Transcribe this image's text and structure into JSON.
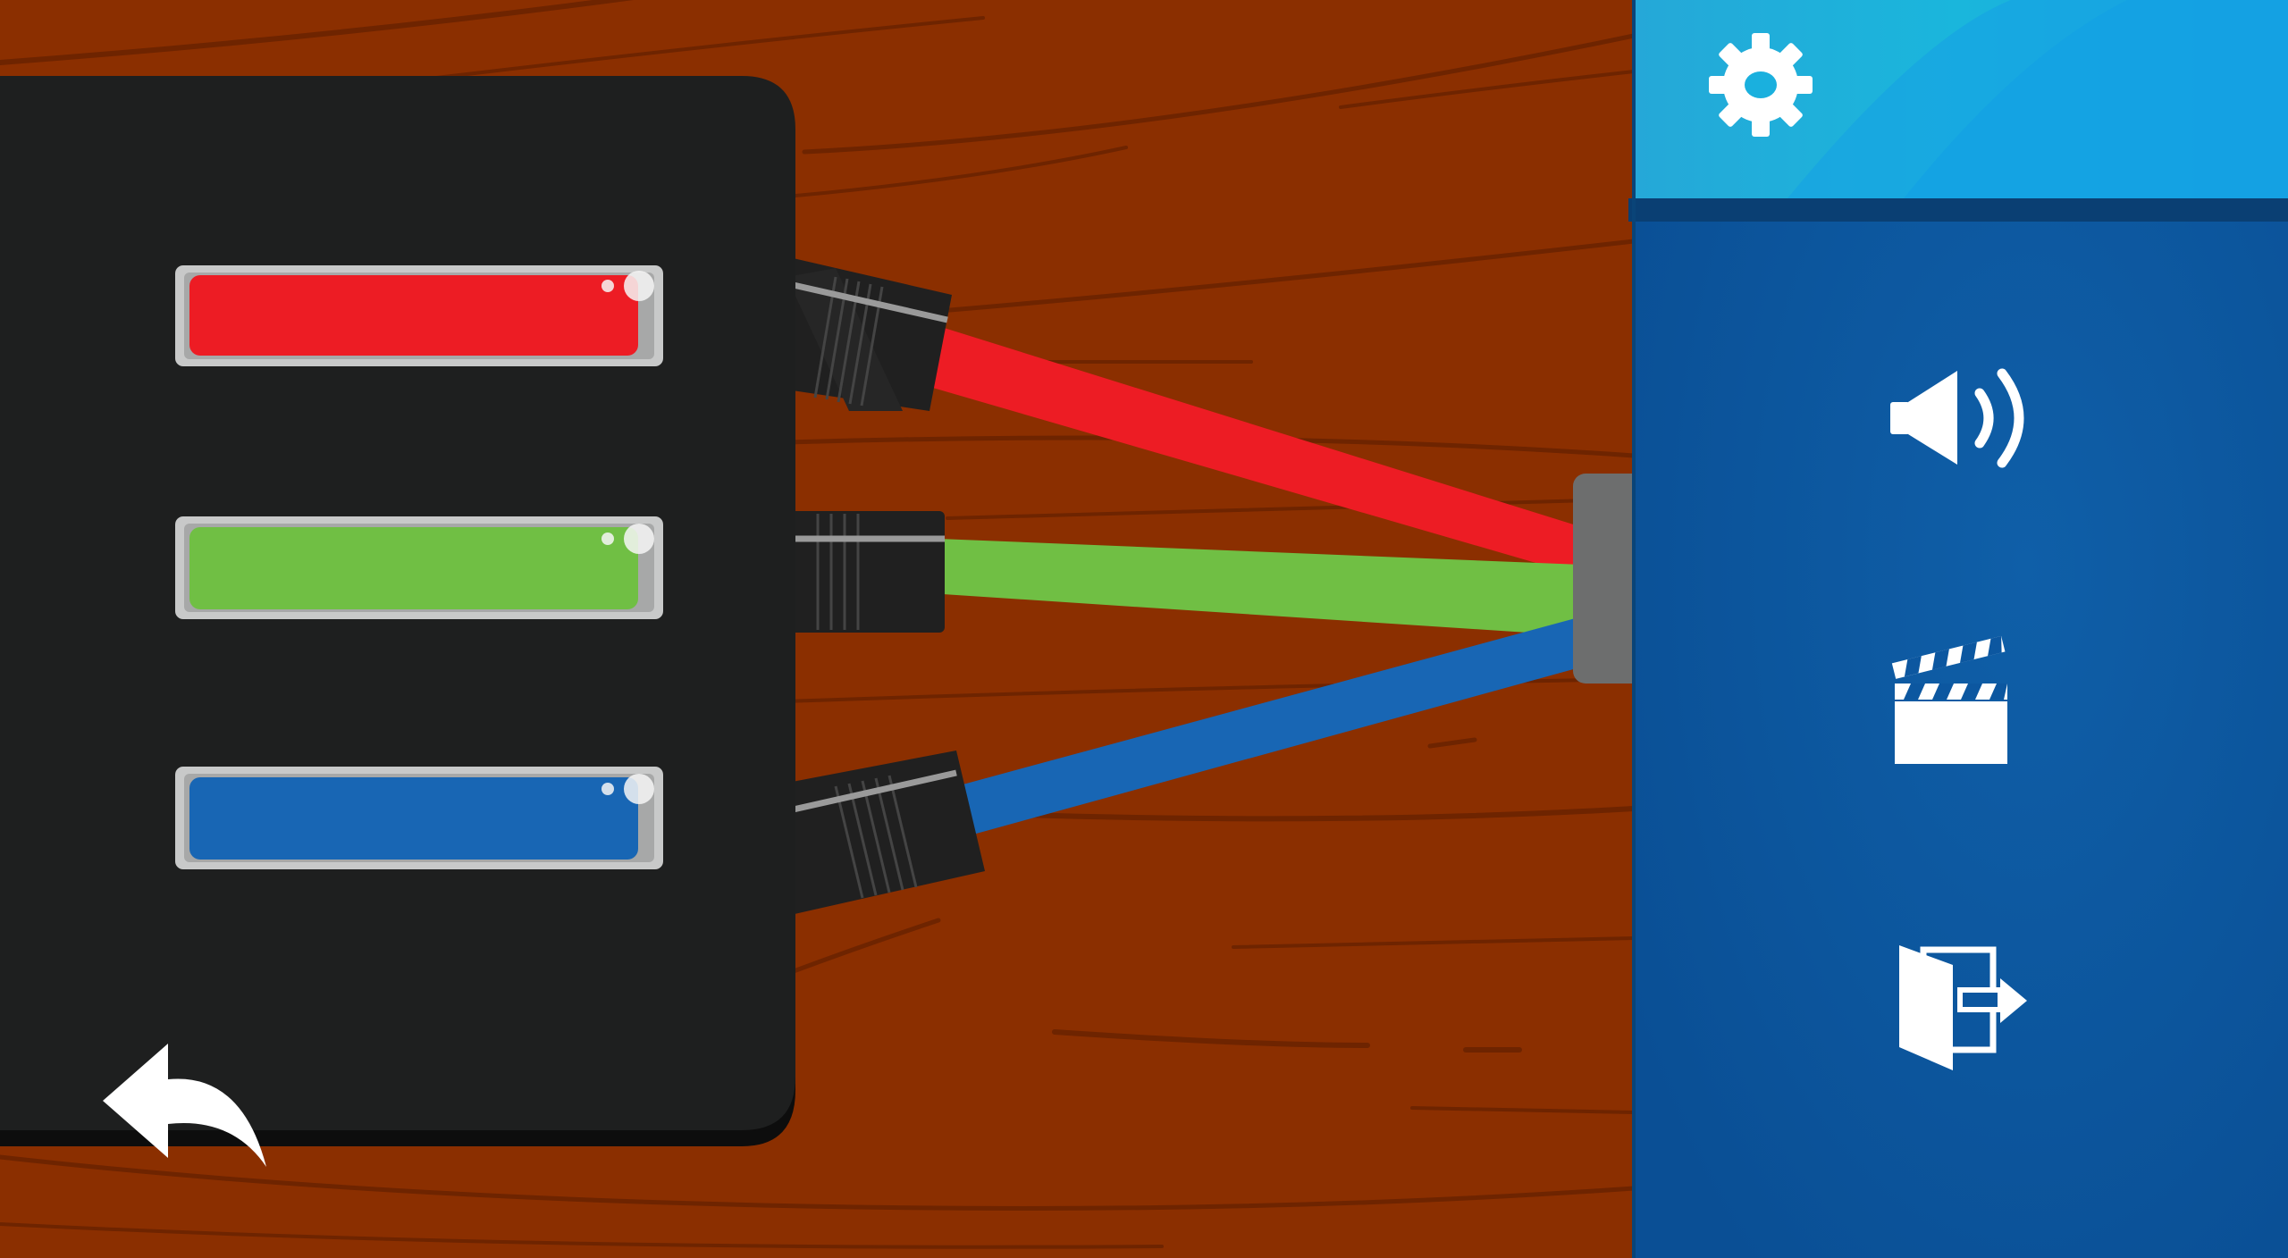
{
  "colors": {
    "wood": "#8b2f00",
    "wood_grain": "#6e2400",
    "device_body": "#1e1f1f",
    "red_wire": "#ed1c24",
    "green_wire": "#70bf44",
    "blue_wire": "#1866b4",
    "connector": "#202020",
    "plug": "#6d6e6e",
    "panel_header": "#1aa3dc",
    "panel_body": "#0d58a0",
    "icon": "#ffffff"
  },
  "game": {
    "lights": [
      {
        "color": "red"
      },
      {
        "color": "green"
      },
      {
        "color": "blue"
      }
    ]
  },
  "panel": {
    "header_icon": "gear-icon",
    "buttons": [
      {
        "name": "sound-button",
        "icon": "speaker-icon"
      },
      {
        "name": "video-button",
        "icon": "clapperboard-icon"
      },
      {
        "name": "exit-button",
        "icon": "exit-door-icon"
      }
    ]
  },
  "back_icon": "back-arrow-icon"
}
